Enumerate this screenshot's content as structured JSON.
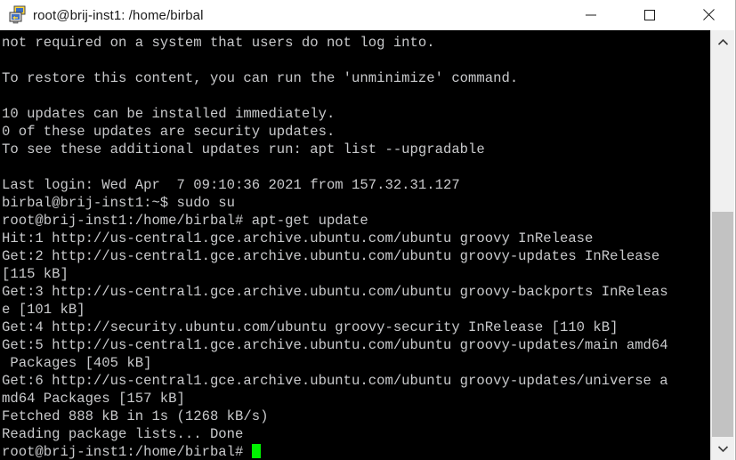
{
  "window": {
    "title": "root@brij-inst1: /home/birbal",
    "icon": "putty-terminal-icon",
    "controls": {
      "minimize_label": "Minimize",
      "maximize_label": "Maximize",
      "close_label": "Close"
    }
  },
  "terminal": {
    "background_color": "#000000",
    "text_color": "#c9cacc",
    "cursor_color": "#00f200",
    "columns": 80,
    "lines": [
      "not required on a system that users do not log into.",
      "",
      "To restore this content, you can run the 'unminimize' command.",
      "",
      "10 updates can be installed immediately.",
      "0 of these updates are security updates.",
      "To see these additional updates run: apt list --upgradable",
      "",
      "Last login: Wed Apr  7 09:10:36 2021 from 157.32.31.127",
      "birbal@brij-inst1:~$ sudo su",
      "root@brij-inst1:/home/birbal# apt-get update",
      "Hit:1 http://us-central1.gce.archive.ubuntu.com/ubuntu groovy InRelease",
      "Get:2 http://us-central1.gce.archive.ubuntu.com/ubuntu groovy-updates InRelease",
      "[115 kB]",
      "Get:3 http://us-central1.gce.archive.ubuntu.com/ubuntu groovy-backports InReleas",
      "e [101 kB]",
      "Get:4 http://security.ubuntu.com/ubuntu groovy-security InRelease [110 kB]",
      "Get:5 http://us-central1.gce.archive.ubuntu.com/ubuntu groovy-updates/main amd64",
      " Packages [405 kB]",
      "Get:6 http://us-central1.gce.archive.ubuntu.com/ubuntu groovy-updates/universe a",
      "md64 Packages [157 kB]",
      "Fetched 888 kB in 1s (1268 kB/s)",
      "Reading package lists... Done"
    ],
    "prompt": "root@brij-inst1:/home/birbal# ",
    "command_input": ""
  },
  "scrollbar": {
    "up_arrow": "chevron-up-icon",
    "down_arrow": "chevron-down-icon"
  }
}
